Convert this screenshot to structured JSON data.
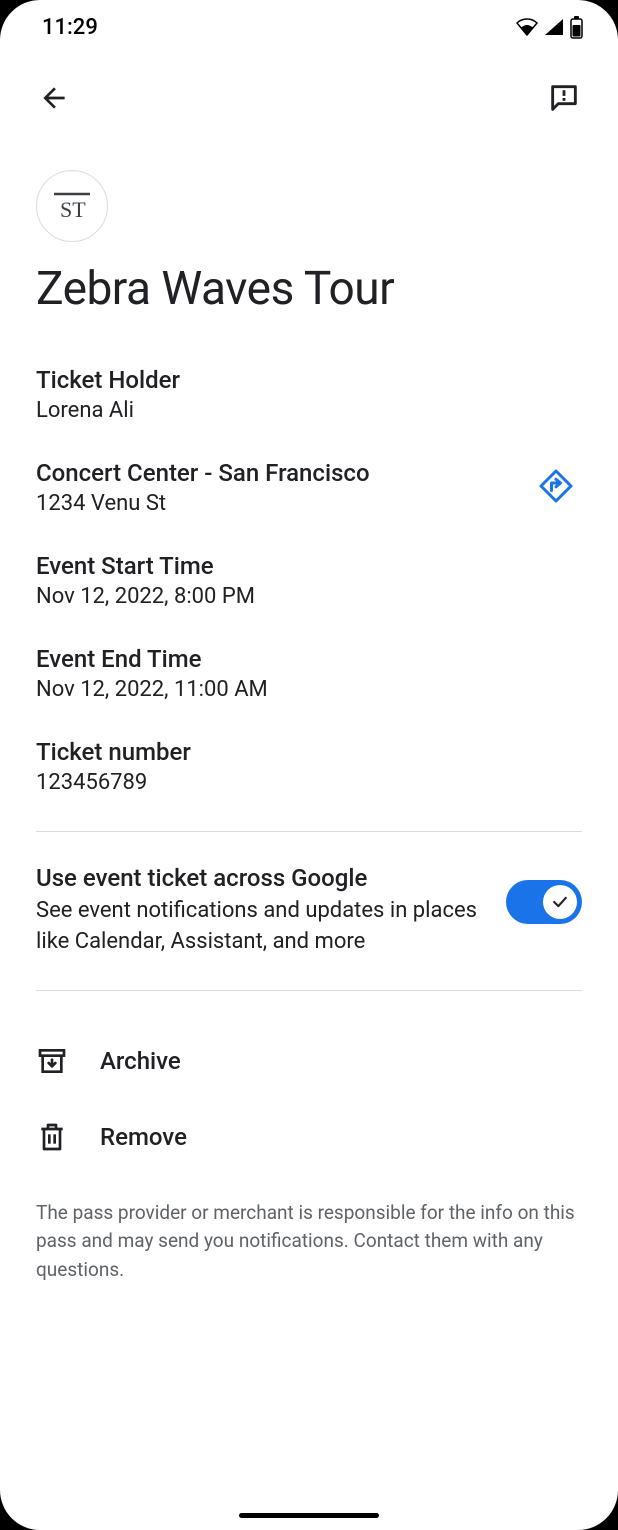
{
  "status": {
    "time": "11:29"
  },
  "logo": {
    "text": "ST"
  },
  "title": "Zebra Waves Tour",
  "details": {
    "holder": {
      "label": "Ticket Holder",
      "value": "Lorena Ali"
    },
    "venue": {
      "label": "Concert Center - San Francisco",
      "value": "1234 Venu St"
    },
    "start": {
      "label": "Event Start Time",
      "value": "Nov 12, 2022, 8:00 PM"
    },
    "end": {
      "label": "Event End Time",
      "value": "Nov 12, 2022, 11:00 AM"
    },
    "ticket": {
      "label": "Ticket number",
      "value": "123456789"
    }
  },
  "toggle": {
    "title": "Use event ticket across Google",
    "description": "See event notifications and updates in places like Calendar, Assistant, and more"
  },
  "actions": {
    "archive": "Archive",
    "remove": "Remove"
  },
  "footer": "The pass provider or merchant is responsible for the info on this pass and may send you notifications. Contact them with any questions."
}
